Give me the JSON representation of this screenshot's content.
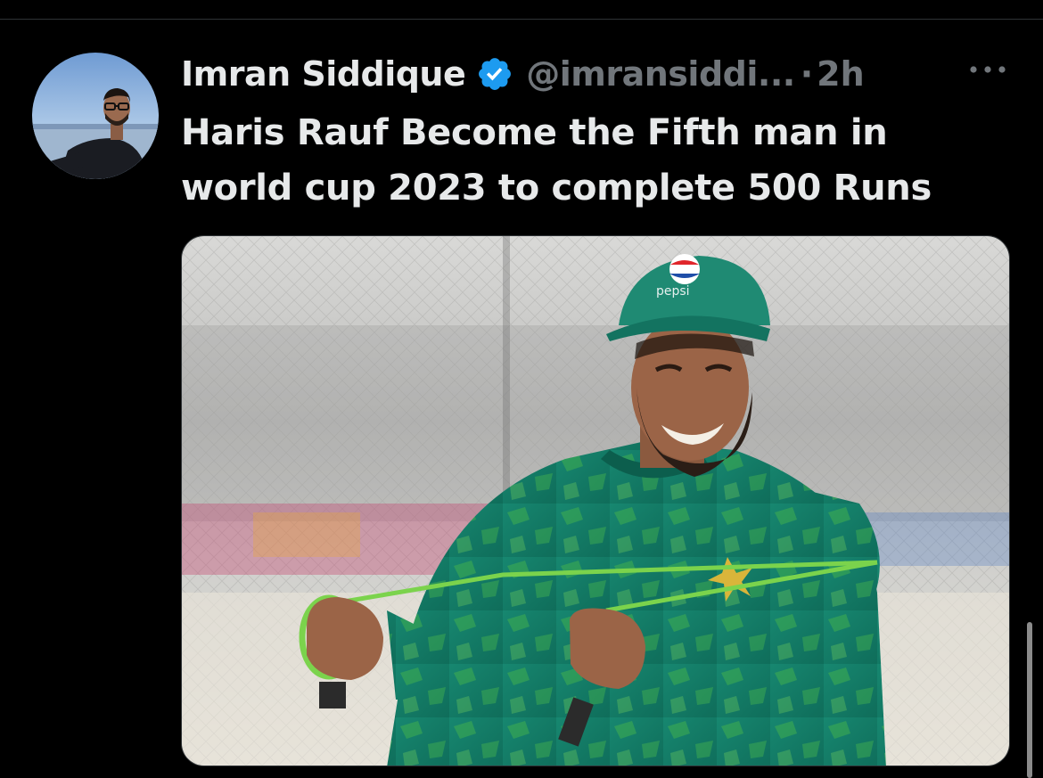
{
  "tweet": {
    "author": {
      "display_name": "Imran Siddique",
      "handle": "@imransiddi...",
      "verified": true
    },
    "separator": "·",
    "time": "2h",
    "text": "Haris Rauf Become the Fifth man in world cup 2023 to complete 500 Runs",
    "media": {
      "cap_logo_text": "pepsi"
    }
  },
  "icons": {
    "verified": "verified-badge-icon",
    "more": "more-options-icon"
  },
  "colors": {
    "background": "#000000",
    "primary_text": "#e7e9ea",
    "secondary_text": "#71767b",
    "verified_blue": "#1d9bf0",
    "jersey_green": "#1b8a6b"
  }
}
